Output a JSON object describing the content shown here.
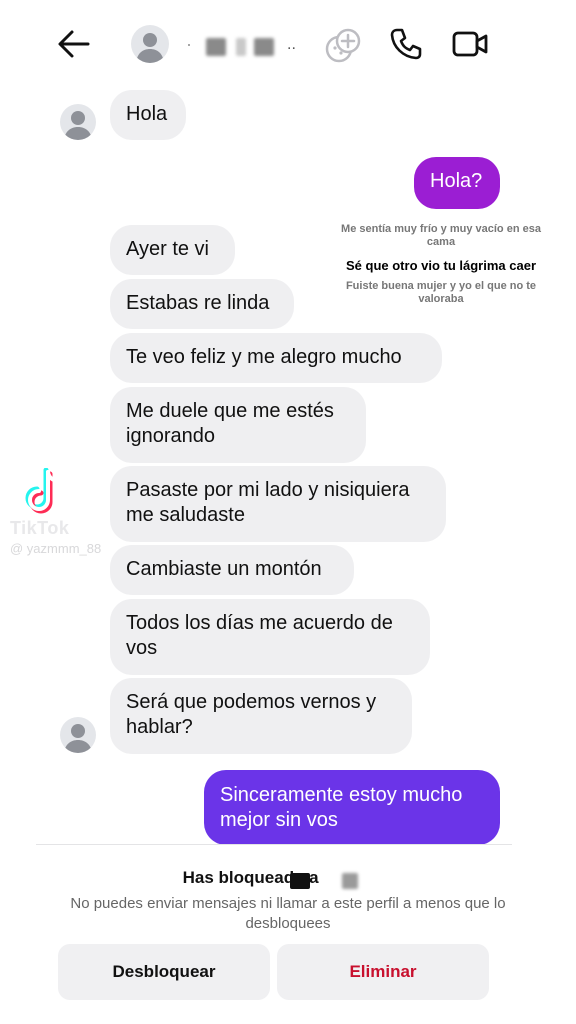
{
  "header": {
    "contact_name": "·",
    "contact_name_tail": ".."
  },
  "messages": [
    {
      "side": "in",
      "text": "Hola"
    },
    {
      "side": "out",
      "text": "Hola?"
    },
    {
      "side": "in",
      "text": "Ayer te vi"
    },
    {
      "side": "in",
      "text": "Estabas re linda"
    },
    {
      "side": "in",
      "text": "Te veo feliz y me alegro mucho"
    },
    {
      "side": "in",
      "text": "Me duele que me estés ignorando"
    },
    {
      "side": "in",
      "text": "Pasaste por mi lado y nisiquiera me saludaste"
    },
    {
      "side": "in",
      "text": "Cambiaste un montón"
    },
    {
      "side": "in",
      "text": "Todos los días me acuerdo de vos"
    },
    {
      "side": "in",
      "text": "Será que podemos vernos y hablar?"
    },
    {
      "side": "out",
      "text": "Sinceramente estoy mucho mejor sin vos"
    }
  ],
  "lyrics": {
    "line1": "Me sentía muy frío y muy vacío en esa cama",
    "line2": "Sé que otro vio tu lágrima caer",
    "line3": "Fuiste buena mujer y yo el que no te valoraba"
  },
  "watermark": {
    "brand": "TikTok",
    "username": "@ yazmmm_88"
  },
  "blocked": {
    "title": "Has bloqueado a",
    "description": "No puedes enviar mensajes ni llamar a este perfil a menos que lo desbloquees",
    "unblock_label": "Desbloquear",
    "delete_label": "Eliminar"
  },
  "colors": {
    "outgoing_first": "#9b1ed3",
    "outgoing_last": "#6b34e8",
    "incoming": "#efeff1",
    "delete_text": "#c8102e"
  }
}
